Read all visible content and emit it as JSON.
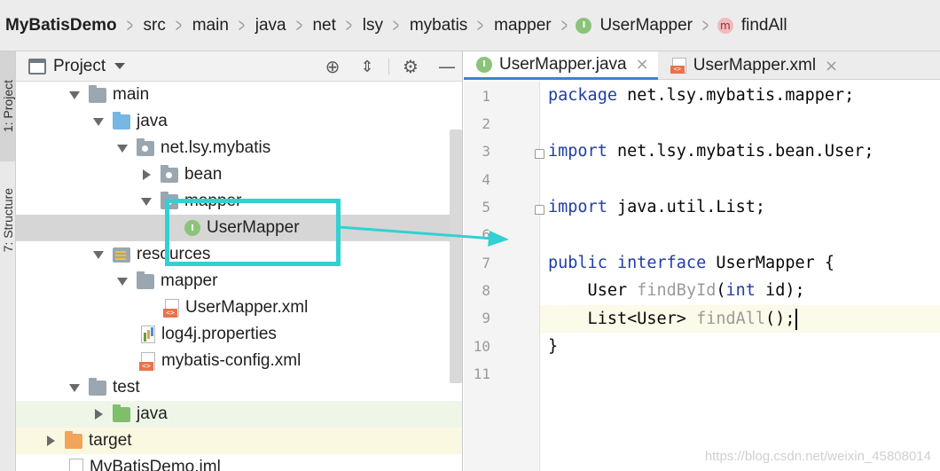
{
  "breadcrumb": {
    "project": "MyBatisDemo",
    "items": [
      "src",
      "main",
      "java",
      "net",
      "lsy",
      "mybatis",
      "mapper"
    ],
    "class_name": "UserMapper",
    "method_name": "findAll"
  },
  "left_strip": {
    "project_tab": "1: Project",
    "structure_tab": "7: Structure"
  },
  "project_panel": {
    "title": "Project",
    "tree": [
      {
        "label": "main",
        "icon": "folder-grey"
      },
      {
        "label": "java",
        "icon": "folder-blue"
      },
      {
        "label": "net.lsy.mybatis",
        "icon": "package"
      },
      {
        "label": "bean",
        "icon": "package"
      },
      {
        "label": "mapper",
        "icon": "package"
      },
      {
        "label": "UserMapper",
        "icon": "interface"
      },
      {
        "label": "resources",
        "icon": "resources-folder"
      },
      {
        "label": "mapper",
        "icon": "folder-grey"
      },
      {
        "label": "UserMapper.xml",
        "icon": "xml-file"
      },
      {
        "label": "log4j.properties",
        "icon": "properties-file"
      },
      {
        "label": "mybatis-config.xml",
        "icon": "xml-file"
      },
      {
        "label": "test",
        "icon": "folder-grey"
      },
      {
        "label": "java",
        "icon": "folder-green"
      },
      {
        "label": "target",
        "icon": "folder-orange"
      },
      {
        "label": "MyBatisDemo.iml",
        "icon": "iml-file"
      }
    ]
  },
  "editor": {
    "tabs": [
      {
        "label": "UserMapper.java",
        "active": true
      },
      {
        "label": "UserMapper.xml",
        "active": false
      }
    ],
    "line_numbers": [
      "1",
      "2",
      "3",
      "4",
      "5",
      "6",
      "7",
      "8",
      "9",
      "10",
      "11"
    ],
    "current_line": 9,
    "code": {
      "l1_kw": "package",
      "l1_rest": " net.lsy.mybatis.mapper;",
      "l3_kw": "import",
      "l3_rest": " net.lsy.mybatis.bean.User;",
      "l5_kw": "import",
      "l5_rest": " java.util.List;",
      "l7_kw1": "public",
      "l7_kw2": "interface",
      "l7_rest": " UserMapper {",
      "l8_type": "    User ",
      "l8_method": "findById",
      "l8_open": "(",
      "l8_kw": "int",
      "l8_rest": " id);",
      "l9_type": "    List<User> ",
      "l9_method": "findAll",
      "l9_rest": "();",
      "l10": "}"
    }
  },
  "watermark": "https://blog.csdn.net/weixin_45808014",
  "colors": {
    "highlight": "#32d0d2",
    "interface_badge": "#8cc37a",
    "keyword": "#1f3ea6",
    "active_tab_underline": "#4083c9"
  }
}
